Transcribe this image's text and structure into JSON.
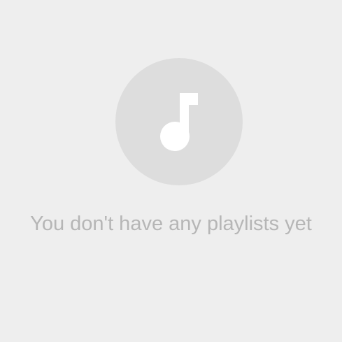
{
  "empty_state": {
    "icon": "music-note-icon",
    "message": "You don't have any playlists yet"
  },
  "colors": {
    "background": "#eeeeee",
    "circle": "#dddddd",
    "icon": "#ffffff",
    "text": "#b6b6b6"
  }
}
